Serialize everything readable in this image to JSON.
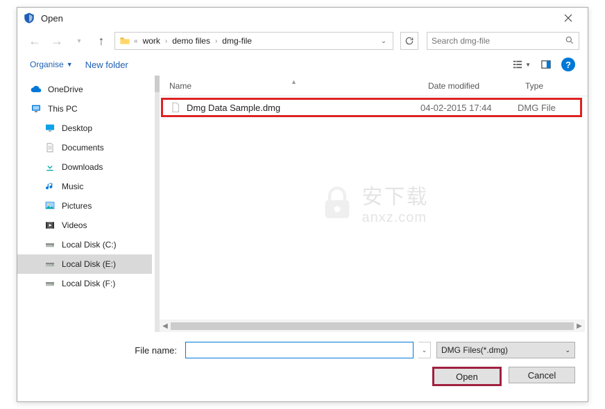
{
  "window": {
    "title": "Open"
  },
  "breadcrumb": {
    "prefix": "«",
    "items": [
      "work",
      "demo files",
      "dmg-file"
    ]
  },
  "search": {
    "placeholder": "Search dmg-file"
  },
  "toolbar": {
    "organise": "Organise",
    "new_folder": "New folder"
  },
  "tree": {
    "items": [
      {
        "label": "OneDrive",
        "icon": "cloud",
        "lvl": 1
      },
      {
        "label": "This PC",
        "icon": "monitor",
        "lvl": 1
      },
      {
        "label": "Desktop",
        "icon": "desktop",
        "lvl": 2
      },
      {
        "label": "Documents",
        "icon": "doc",
        "lvl": 2
      },
      {
        "label": "Downloads",
        "icon": "download",
        "lvl": 2
      },
      {
        "label": "Music",
        "icon": "music",
        "lvl": 2
      },
      {
        "label": "Pictures",
        "icon": "picture",
        "lvl": 2
      },
      {
        "label": "Videos",
        "icon": "video",
        "lvl": 2
      },
      {
        "label": "Local Disk (C:)",
        "icon": "disk",
        "lvl": 2
      },
      {
        "label": "Local Disk (E:)",
        "icon": "disk",
        "lvl": 2,
        "selected": true
      },
      {
        "label": "Local Disk (F:)",
        "icon": "disk",
        "lvl": 2
      }
    ]
  },
  "columns": {
    "name": "Name",
    "date": "Date modified",
    "type": "Type"
  },
  "files": [
    {
      "name": "Dmg Data Sample.dmg",
      "date": "04-02-2015 17:44",
      "type": "DMG File",
      "highlighted": true
    }
  ],
  "watermark": {
    "cn": "安下载",
    "en": "anxz.com"
  },
  "bottom": {
    "filename_label": "File name:",
    "filename_value": "",
    "filter": "DMG Files(*.dmg)",
    "open": "Open",
    "cancel": "Cancel"
  }
}
